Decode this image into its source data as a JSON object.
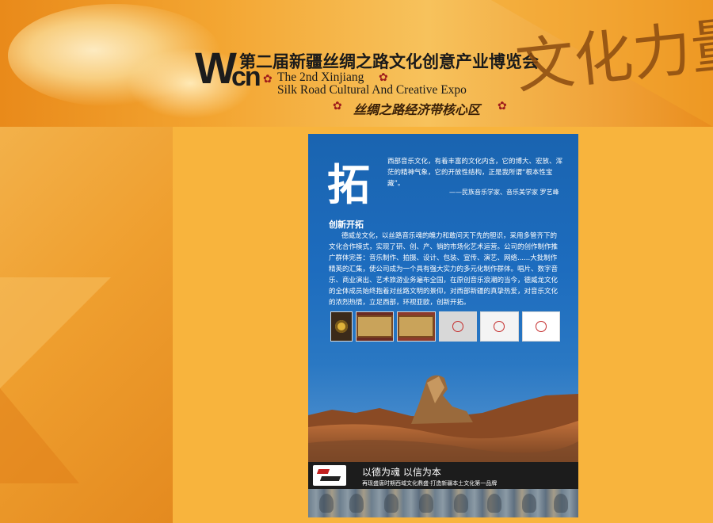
{
  "banner": {
    "logo_letter": "W",
    "logo_sub": "cn",
    "title_cn": "第二届新疆丝绸之路文化创意产业博览会",
    "title_en_line1": "The 2nd Xinjiang",
    "title_en_line2": "Silk Road Cultural And Creative Expo",
    "subtitle_cn": "丝绸之路经济带核心区",
    "calligraphy": "文化力量"
  },
  "poster": {
    "big_char": "拓",
    "quote": "西部音乐文化，有着丰富的文化内含，它的博大、宏放、浑茫的精神气象，它的开放性结构，正是我所谓“根本性宝藏”。",
    "attribution": "——民族音乐学家、音乐美学家 罗艺峰",
    "section_title": "创新开拓",
    "body": "德威龙文化，以丝路音乐魂的魄力和敢问天下先的胆识，采用多管齐下的文化合作模式，实现了研、创、产、销的市场化艺术运营。公司的创作制作推广群体完善：音乐制作、拍摄、设计、包装、宣传、演艺、网络......大批制作精英的汇集，使公司成为一个具有强大实力的多元化制作群体。唱片、数字音乐、商业演出、艺术旅游业务遍布全国，在原创音乐浪潮的当今，德威龙文化的全体成员始终抱着对丝路文明的景仰，对西部新疆的真挚热爱，对音乐文化的浓烈热情，立足西部，环视亚欧，创新开拓。",
    "footer_motto": "以德为魂   以信为本",
    "footer_sub": "再现盛唐时期西域文化鼎盛·打造新疆本土文化第一品牌"
  },
  "colors": {
    "page_bg": "#f0a532",
    "poster_blue": "#1a64b0",
    "accent_red": "#9e1b1b"
  }
}
